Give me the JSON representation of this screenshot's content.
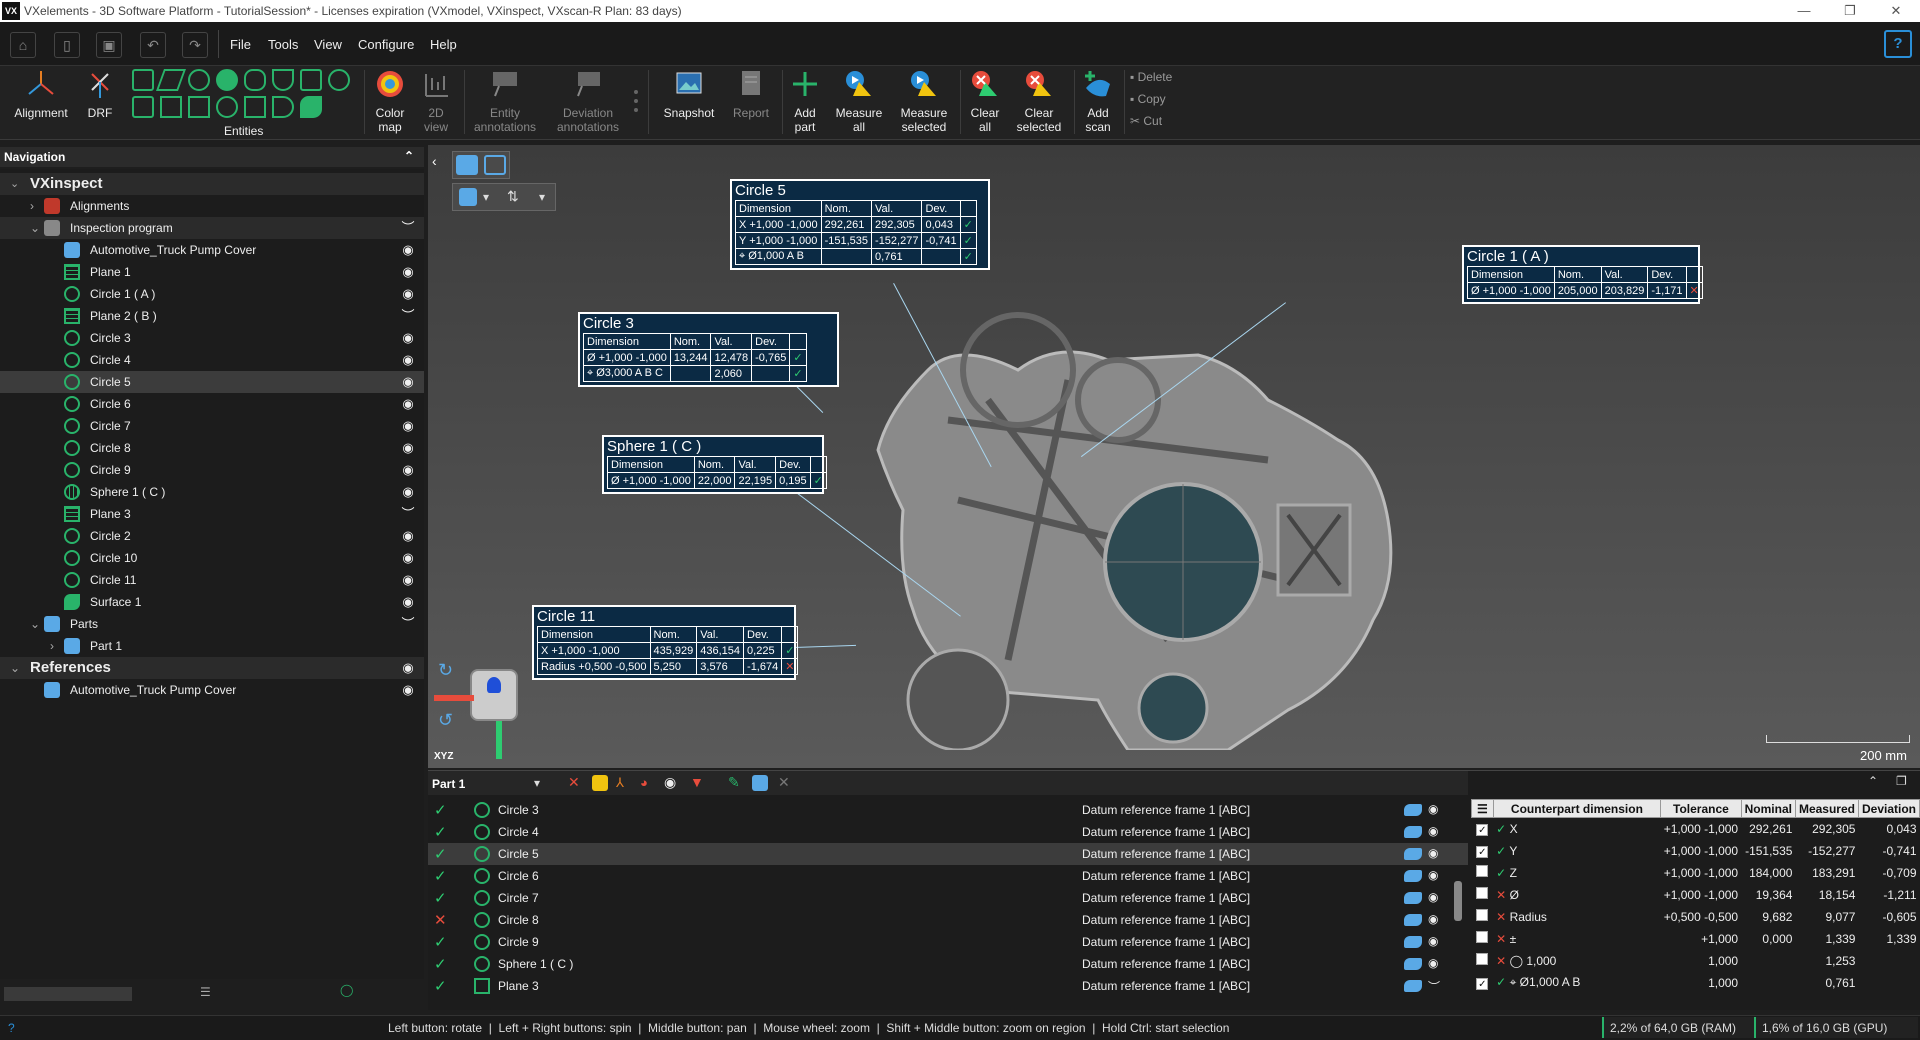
{
  "title": "VXelements - 3D Software Platform - TutorialSession* - Licenses expiration (VXmodel, VXinspect, VXscan-R Plan: 83 days)",
  "logo": "VX",
  "menu": [
    "File",
    "Tools",
    "View",
    "Configure",
    "Help"
  ],
  "ribbon": {
    "alignment": "Alignment",
    "drf": "DRF",
    "entities": "Entities",
    "color_map": [
      "Color",
      "map"
    ],
    "view2d": [
      "2D",
      "view"
    ],
    "entity_ann": [
      "Entity",
      "annotations"
    ],
    "deviation_ann": [
      "Deviation",
      "annotations"
    ],
    "snapshot": "Snapshot",
    "report": "Report",
    "add_part": [
      "Add",
      "part"
    ],
    "measure_all": [
      "Measure",
      "all"
    ],
    "measure_selected": [
      "Measure",
      "selected"
    ],
    "clear_all": [
      "Clear",
      "all"
    ],
    "clear_selected": [
      "Clear",
      "selected"
    ],
    "add_scan": [
      "Add",
      "scan"
    ],
    "delete": "Delete",
    "copy": "Copy",
    "cut": "Cut"
  },
  "navigation": {
    "header": "Navigation",
    "root": "VXinspect",
    "alignments": "Alignments",
    "program": "Inspection program",
    "items": [
      "Automotive_Truck Pump Cover",
      "Plane 1",
      "Circle 1 ( A )",
      "Plane 2 ( B )",
      "Circle 3",
      "Circle 4",
      "Circle 5",
      "Circle 6",
      "Circle 7",
      "Circle 8",
      "Circle 9",
      "Sphere 1 ( C )",
      "Plane 3",
      "Circle 2",
      "Circle 10",
      "Circle 11",
      "Surface 1"
    ],
    "parts": "Parts",
    "part1": "Part 1",
    "references": "References",
    "ref_item": "Automotive_Truck Pump Cover"
  },
  "annotations": {
    "circle5": {
      "title": "Circle 5",
      "rows": [
        [
          "X +1,000 -1,000",
          "292,261",
          "292,305",
          "0,043"
        ],
        [
          "Y +1,000 -1,000",
          "-151,535",
          "-152,277",
          "-0,741"
        ],
        [
          "⌖ Ø1,000 A B",
          "",
          "0,761",
          ""
        ]
      ]
    },
    "circle3": {
      "title": "Circle 3",
      "rows": [
        [
          "Ø +1,000 -1,000",
          "13,244",
          "12,478",
          "-0,765"
        ],
        [
          "⌖ Ø3,000 A B C",
          "",
          "2,060",
          ""
        ]
      ]
    },
    "sphere1": {
      "title": "Sphere 1 ( C )",
      "rows": [
        [
          "Ø +1,000 -1,000",
          "22,000",
          "22,195",
          "0,195"
        ]
      ]
    },
    "circle11": {
      "title": "Circle 11",
      "rows": [
        [
          "X +1,000 -1,000",
          "435,929",
          "436,154",
          "0,225"
        ],
        [
          "Radius +0,500 -0,500",
          "5,250",
          "3,576",
          "-1,674"
        ]
      ]
    },
    "circle1": {
      "title": "Circle 1 ( A )",
      "rows": [
        [
          "Ø +1,000 -1,000",
          "205,000",
          "203,829",
          "-1,171"
        ]
      ]
    },
    "headers": [
      "Dimension",
      "Nom.",
      "Val.",
      "Dev."
    ]
  },
  "scale": "200 mm",
  "axes": "XYZ",
  "part_panel": {
    "selector": "Part 1",
    "rows": [
      {
        "name": "Circle 3",
        "drf": "Datum reference frame 1 [ABC]",
        "ok": true
      },
      {
        "name": "Circle 4",
        "drf": "Datum reference frame 1 [ABC]",
        "ok": true
      },
      {
        "name": "Circle 5",
        "drf": "Datum reference frame 1 [ABC]",
        "ok": true
      },
      {
        "name": "Circle 6",
        "drf": "Datum reference frame 1 [ABC]",
        "ok": true
      },
      {
        "name": "Circle 7",
        "drf": "Datum reference frame 1 [ABC]",
        "ok": true
      },
      {
        "name": "Circle 8",
        "drf": "Datum reference frame 1 [ABC]",
        "ok": false
      },
      {
        "name": "Circle 9",
        "drf": "Datum reference frame 1 [ABC]",
        "ok": true
      },
      {
        "name": "Sphere 1 ( C )",
        "drf": "Datum reference frame 1 [ABC]",
        "ok": true
      },
      {
        "name": "Plane 3",
        "drf": "Datum reference frame 1 [ABC]",
        "ok": true
      }
    ]
  },
  "dim_table": {
    "headers": [
      "Counterpart dimension",
      "Tolerance",
      "Nominal",
      "Measured",
      "Deviation"
    ],
    "rows": [
      {
        "name": "X",
        "tol": "+1,000 -1,000",
        "nom": "292,261",
        "meas": "292,305",
        "dev": "0,043",
        "ok": true,
        "checked": true
      },
      {
        "name": "Y",
        "tol": "+1,000 -1,000",
        "nom": "-151,535",
        "meas": "-152,277",
        "dev": "-0,741",
        "ok": true,
        "checked": true
      },
      {
        "name": "Z",
        "tol": "+1,000 -1,000",
        "nom": "184,000",
        "meas": "183,291",
        "dev": "-0,709",
        "ok": true,
        "checked": false
      },
      {
        "name": "Ø",
        "tol": "+1,000 -1,000",
        "nom": "19,364",
        "meas": "18,154",
        "dev": "-1,211",
        "ok": false,
        "checked": false
      },
      {
        "name": "Radius",
        "tol": "+0,500 -0,500",
        "nom": "9,682",
        "meas": "9,077",
        "dev": "-0,605",
        "ok": false,
        "checked": false
      },
      {
        "name": "±",
        "tol": "+1,000",
        "nom": "0,000",
        "meas": "1,339",
        "dev": "1,339",
        "ok": false,
        "checked": false
      },
      {
        "name": "◯ 1,000",
        "tol": "1,000",
        "nom": "",
        "meas": "1,253",
        "dev": "",
        "ok": false,
        "checked": false
      },
      {
        "name": "⌖ Ø1,000 A B",
        "tol": "1,000",
        "nom": "",
        "meas": "0,761",
        "dev": "",
        "ok": true,
        "checked": true
      }
    ]
  },
  "status": {
    "help": "?",
    "hint": "Left button: rotate  |  Left + Right buttons: spin  |  Middle button: pan  |  Mouse wheel: zoom  |  Shift + Middle button: zoom on region  |  Hold Ctrl: start selection",
    "ram": "2,2% of 64,0 GB (RAM)",
    "gpu": "1,6% of 16,0 GB (GPU)"
  }
}
